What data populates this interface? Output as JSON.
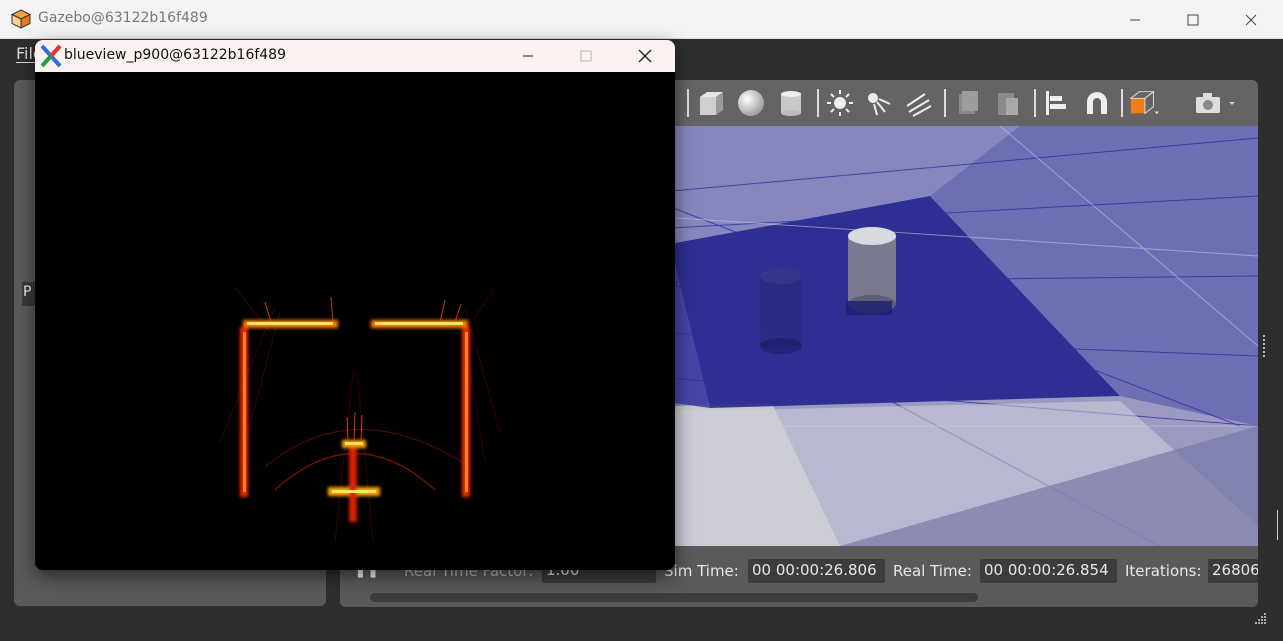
{
  "gazebo": {
    "title": "Gazebo@63122b16f489",
    "menu": {
      "file_label": "File"
    },
    "left_panel": {
      "tab_label": "P"
    },
    "toolbar": {
      "tools": [
        "box-icon",
        "sphere-icon",
        "cylinder-icon",
        "sun-light-icon",
        "point-light-icon",
        "directional-light-icon",
        "copy-icon",
        "paste-icon",
        "align-icon",
        "magnet-icon",
        "view-angle-icon",
        "camera-icon"
      ]
    },
    "status_bar": {
      "pause_label": "❚❚",
      "real_time_factor_label": "Real Time Factor:",
      "real_time_factor_value": "1.00",
      "sim_time_label": "Sim Time:",
      "sim_time_value": "00 00:00:26.806",
      "real_time_label": "Real Time:",
      "real_time_value": "00 00:00:26.854",
      "iterations_label": "Iterations:",
      "iterations_value": "26806"
    },
    "colors": {
      "accent_orange": "#f07d1a",
      "scene_blue": "#1e1e8c"
    }
  },
  "sonar_window": {
    "title": "blueview_p900@63122b16f489"
  }
}
